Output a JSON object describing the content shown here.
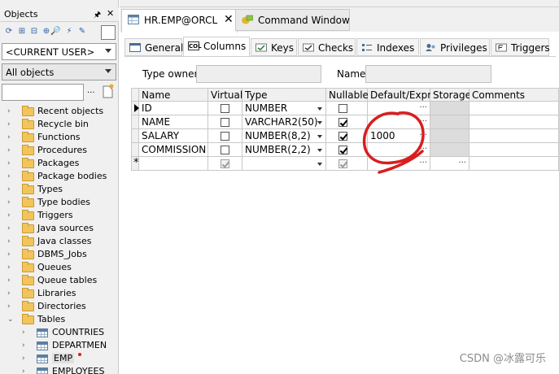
{
  "objects_panel": {
    "title": "Objects",
    "user_filter": "<CURRENT USER>",
    "object_filter": "All objects",
    "search_value": "",
    "more_label": "...",
    "tree": [
      {
        "label": "Recent objects",
        "type": "folder",
        "expanded": false
      },
      {
        "label": "Recycle bin",
        "type": "folder",
        "expanded": false
      },
      {
        "label": "Functions",
        "type": "folder",
        "expanded": false
      },
      {
        "label": "Procedures",
        "type": "folder",
        "expanded": false
      },
      {
        "label": "Packages",
        "type": "folder",
        "expanded": false
      },
      {
        "label": "Package bodies",
        "type": "folder",
        "expanded": false
      },
      {
        "label": "Types",
        "type": "folder",
        "expanded": false
      },
      {
        "label": "Type bodies",
        "type": "folder",
        "expanded": false
      },
      {
        "label": "Triggers",
        "type": "folder",
        "expanded": false
      },
      {
        "label": "Java sources",
        "type": "folder",
        "expanded": false
      },
      {
        "label": "Java classes",
        "type": "folder",
        "expanded": false
      },
      {
        "label": "DBMS_Jobs",
        "type": "folder",
        "expanded": false
      },
      {
        "label": "Queues",
        "type": "folder",
        "expanded": false
      },
      {
        "label": "Queue tables",
        "type": "folder",
        "expanded": false
      },
      {
        "label": "Libraries",
        "type": "folder",
        "expanded": false
      },
      {
        "label": "Directories",
        "type": "folder",
        "expanded": false
      },
      {
        "label": "Tables",
        "type": "folder",
        "expanded": true
      },
      {
        "label": "COUNTRIES",
        "type": "table",
        "expanded": false
      },
      {
        "label": "DEPARTMEN",
        "type": "table",
        "expanded": false
      },
      {
        "label": "EMP",
        "type": "table",
        "expanded": false,
        "selected": true,
        "modified": true
      },
      {
        "label": "EMPLOYEES",
        "type": "table",
        "expanded": false
      }
    ]
  },
  "doc_tabs": [
    {
      "label": "HR.EMP@ORCL",
      "active": true,
      "close": "✕"
    },
    {
      "label": "Command Window",
      "active": false
    }
  ],
  "sub_tabs": [
    {
      "label": "General",
      "icon": "general-icon"
    },
    {
      "label": "Columns",
      "icon": "columns-icon",
      "icon_text": "COL",
      "active": true
    },
    {
      "label": "Keys",
      "icon": "keys-icon"
    },
    {
      "label": "Checks",
      "icon": "checks-icon"
    },
    {
      "label": "Indexes",
      "icon": "indexes-icon"
    },
    {
      "label": "Privileges",
      "icon": "privileges-icon"
    },
    {
      "label": "Triggers",
      "icon": "triggers-icon"
    }
  ],
  "form": {
    "type_owner_label": "Type owner",
    "type_owner_value": "",
    "name_label": "Name",
    "name_value": ""
  },
  "grid": {
    "headers": [
      "Name",
      "Virtual",
      "Type",
      "Nullable",
      "Default/Expr.",
      "Storage",
      "Comments"
    ],
    "rows": [
      {
        "name": "ID",
        "virtual": false,
        "type": "NUMBER",
        "nullable": false,
        "default": "",
        "current": true
      },
      {
        "name": "NAME",
        "virtual": false,
        "type": "VARCHAR2(50)",
        "nullable": true,
        "default": ""
      },
      {
        "name": "SALARY",
        "virtual": false,
        "type": "NUMBER(8,2)",
        "nullable": true,
        "default": "1000"
      },
      {
        "name": "COMMISSION",
        "virtual": false,
        "type": "NUMBER(2,2)",
        "nullable": true,
        "default": ""
      },
      {
        "name": "",
        "virtual": true,
        "type": "",
        "nullable": true,
        "default": "",
        "new_row": true
      }
    ],
    "new_row_marker": "*",
    "ellipsis": "..."
  },
  "watermark": "CSDN @冰露可乐",
  "colors": {
    "annotation": "#d81e1e",
    "storage_cell": "#dcdcdc",
    "folder": "#f2c55c"
  }
}
